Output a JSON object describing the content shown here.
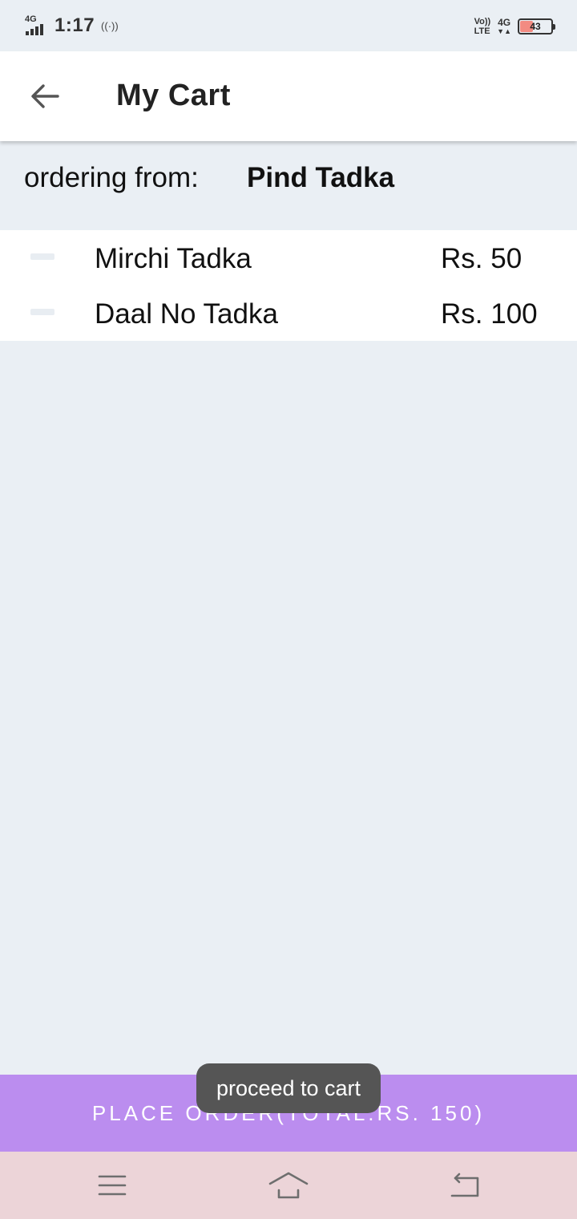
{
  "status_bar": {
    "network_left": "4G",
    "time": "1:17",
    "hotspot": "((·))",
    "volte_top": "Vo))",
    "volte_bottom": "LTE",
    "network_right": "4G",
    "network_arrows": "▼▲",
    "battery_level": "43",
    "battery_fraction": 0.43,
    "battery_color": "#f28b82"
  },
  "header": {
    "title": "My Cart",
    "back_icon": "arrow-back-icon"
  },
  "ordering": {
    "label": "ordering from:",
    "restaurant": "Pind Tadka"
  },
  "cart": {
    "items": [
      {
        "name": "Mirchi Tadka",
        "price": "Rs. 50"
      },
      {
        "name": "Daal No Tadka",
        "price": "Rs. 100"
      }
    ]
  },
  "footer": {
    "place_order_label": "PLACE ORDER(TOTAL:RS. 150)",
    "accent_color": "#bb8def"
  },
  "toast": {
    "text": "proceed to cart"
  },
  "nav": {
    "icons": [
      "menu-icon",
      "home-icon",
      "back-icon"
    ]
  }
}
